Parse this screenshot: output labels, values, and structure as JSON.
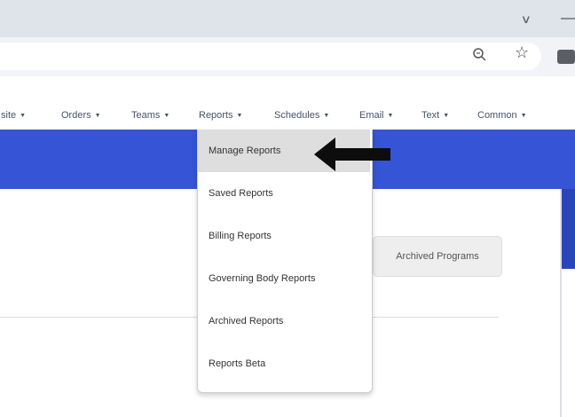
{
  "browser": {
    "icons": {
      "tab_chevron": "chevron-down-icon",
      "minimize": "minimize-icon",
      "zoom": "magnifier-icon",
      "star": "star-icon",
      "extension": "extension-icon"
    }
  },
  "nav": {
    "items": [
      "site",
      "Orders",
      "Teams",
      "Reports",
      "Schedules",
      "Email",
      "Text",
      "Common"
    ]
  },
  "reports_menu": {
    "items": [
      "Manage Reports",
      "Saved Reports",
      "Billing Reports",
      "Governing Body Reports",
      "Archived Reports",
      "Reports Beta"
    ],
    "highlighted": "Manage Reports"
  },
  "main": {
    "archived_programs_button": "Archived Programs"
  },
  "annotation": {
    "arrow": "black arrow pointing left at Manage Reports"
  },
  "colors": {
    "brand_blue": "#3555d6",
    "menu_highlight": "#dedede",
    "nav_text": "#44546a"
  }
}
